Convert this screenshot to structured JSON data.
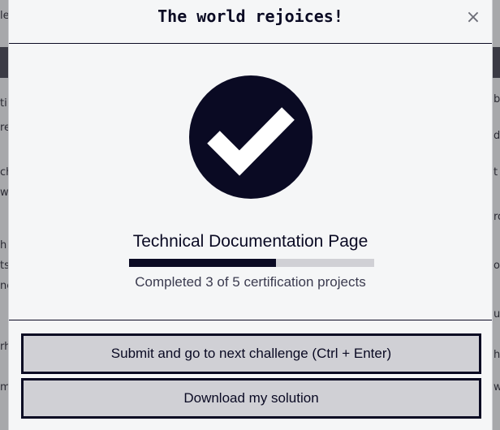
{
  "background": {
    "fragments": [
      "le",
      "ti",
      "re",
      "ch",
      "w",
      "h",
      "ts",
      "nc",
      "rh",
      "m",
      "b",
      "d",
      "t",
      "ro",
      "ov",
      "ui",
      "h",
      "w"
    ]
  },
  "modal": {
    "title": "The world rejoices!",
    "close_label": "×",
    "project_title": "Technical Documentation Page",
    "progress": {
      "completed": 3,
      "total": 5,
      "fraction": 0.6,
      "text": "Completed 3 of 5 certification projects"
    },
    "buttons": {
      "submit_label": "Submit and go to next challenge (Ctrl + Enter)",
      "download_label": "Download my solution"
    }
  },
  "colors": {
    "ink": "#0a0a23",
    "panel": "#f5f6f7",
    "button_bg": "#d0d0d5"
  }
}
